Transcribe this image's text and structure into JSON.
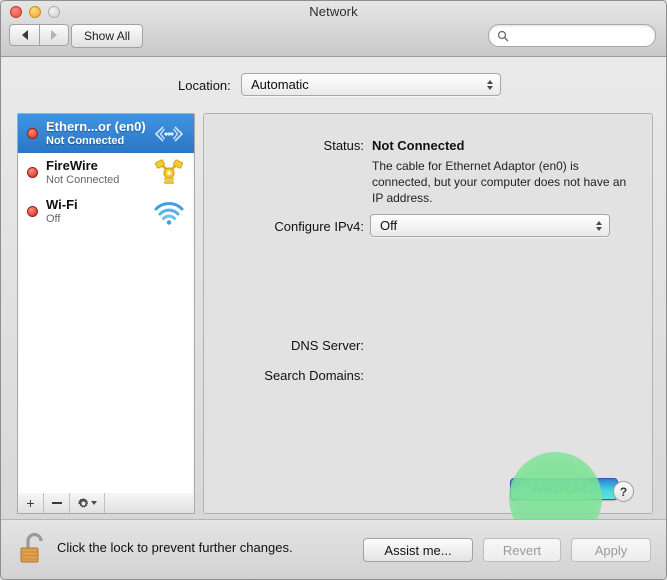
{
  "window": {
    "title": "Network",
    "traffic_lights": [
      "close",
      "minimize",
      "zoom"
    ]
  },
  "toolbar": {
    "back_icon": "back-arrow-icon",
    "forward_icon": "forward-arrow-icon",
    "show_all_label": "Show All",
    "search": {
      "placeholder": "",
      "value": "",
      "icon": "search-icon"
    }
  },
  "location": {
    "label": "Location:",
    "value": "Automatic",
    "options": [
      "Automatic"
    ]
  },
  "sidebar": {
    "services": [
      {
        "name": "Ethern...or (en0)",
        "status": "Not Connected",
        "status_color": "#cc2a1d",
        "icon": "ethernet-icon",
        "selected": true
      },
      {
        "name": "FireWire",
        "status": "Not Connected",
        "status_color": "#cc2a1d",
        "icon": "firewire-icon",
        "selected": false
      },
      {
        "name": "Wi-Fi",
        "status": "Off",
        "status_color": "#cc2a1d",
        "icon": "wifi-icon",
        "selected": false
      }
    ],
    "toolbar": {
      "add_label": "+",
      "remove_label": "–",
      "action_icon": "gear-icon"
    }
  },
  "detail": {
    "status_label": "Status:",
    "status_value": "Not Connected",
    "status_description": "The cable for Ethernet Adaptor (en0) is connected, but your computer does not have an IP address.",
    "configure_ipv4_label": "Configure IPv4:",
    "configure_ipv4_value": "Off",
    "configure_ipv4_options": [
      "Off"
    ],
    "dns_server_label": "DNS Server:",
    "dns_server_value": "",
    "search_domains_label": "Search Domains:",
    "search_domains_value": "",
    "advanced_label": "Advanced...",
    "help_label": "?",
    "highlight_color": "#7ee296"
  },
  "footer": {
    "lock_icon": "unlocked-padlock-icon",
    "lock_text": "Click the lock to prevent further changes.",
    "assist_me_label": "Assist me...",
    "revert_label": "Revert",
    "apply_label": "Apply"
  }
}
